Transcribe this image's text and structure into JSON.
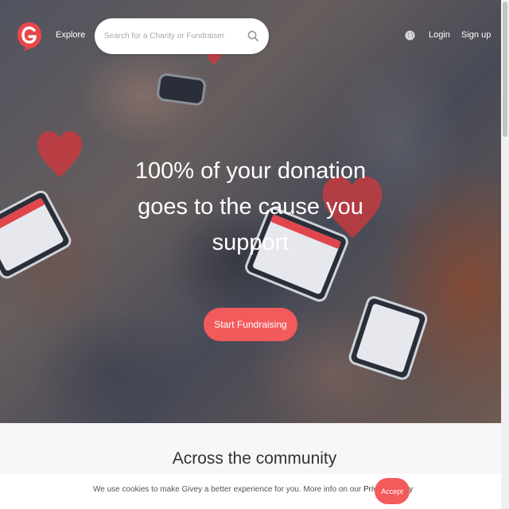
{
  "navbar": {
    "brand_color": "#e8484c",
    "explore_label": "Explore",
    "search_placeholder": "Search for a Charity or Fundraiser",
    "search_icon": "search-icon",
    "language_icon": "globe-icon",
    "login_label": "Login",
    "signup_label": "Sign up"
  },
  "hero": {
    "headline": "100% of your donation goes to the cause you support",
    "cta_label": "Start Fundraising",
    "cta_color": "#f25a5c",
    "decoration_icon": "heart-icon"
  },
  "community": {
    "title": "Across the community"
  },
  "cookie_banner": {
    "text": "We use cookies to make Givey a better experience for you. More info on our",
    "link_label": "Privacy Policy",
    "accept_label": "Accept"
  }
}
